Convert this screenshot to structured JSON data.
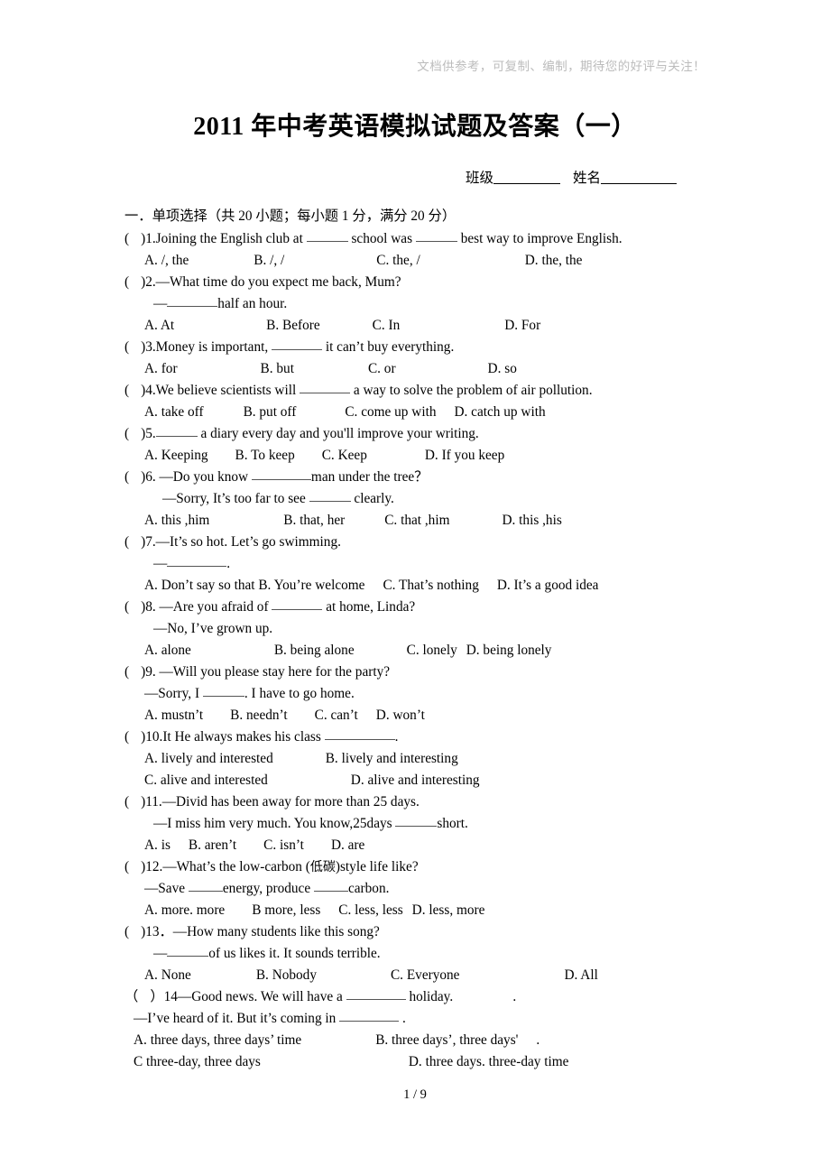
{
  "watermark": "文档供参考，可复制、编制，期待您的好评与关注！",
  "title": "2011 年中考英语模拟试题及答案（一）",
  "id_line": {
    "class_label": "班级",
    "name_label": "姓名"
  },
  "section": {
    "heading": "一．单项选择（共 20 小题；每小题 1 分，满分 20 分）"
  },
  "questions": [
    {
      "number": "1",
      "stem_a": ")1.Joining the English club at",
      "stem_b": "school was",
      "stem_c": "best way to improve English.",
      "options": [
        "A. /, the",
        "B. /, /",
        "C. the, /",
        "D. the, the"
      ]
    },
    {
      "number": "2",
      "stem_a": ")2.—What time do you expect me back, Mum?",
      "reply_pre": "—",
      "reply_post": "half an hour.",
      "options": [
        "A. At",
        "B. Before",
        "C. In",
        "D. For"
      ]
    },
    {
      "number": "3",
      "stem_a": ")3.Money is important,",
      "stem_b": "it can’t buy everything.",
      "options": [
        "A. for",
        "B. but",
        "C. or",
        "D. so"
      ]
    },
    {
      "number": "4",
      "stem_a": ")4.We believe scientists will",
      "stem_b": "a way to solve the problem of air pollution.",
      "options": [
        "A. take off",
        "B. put off",
        "C. come up with",
        "D. catch up with"
      ]
    },
    {
      "number": "5",
      "stem_a": ")5.",
      "stem_b": "a diary every day and you'll improve your writing.",
      "options": [
        "A. Keeping",
        "B. To keep",
        "C. Keep",
        "D. If you keep"
      ]
    },
    {
      "number": "6",
      "stem_a": ")6. —Do you know",
      "stem_b": "man under the tree？",
      "reply_pre": "—Sorry, It’s too far to see",
      "reply_post": "clearly.",
      "options": [
        "A. this ,him",
        "B. that, her",
        "C. that ,him",
        "D. this ,his"
      ]
    },
    {
      "number": "7",
      "stem_a": ")7.—It’s so hot. Let’s go swimming.",
      "reply_pre": "—",
      "reply_post": ".",
      "options": [
        "A. Don’t say so that",
        "B. You’re welcome",
        "C. That’s nothing",
        "D. It’s a good idea"
      ]
    },
    {
      "number": "8",
      "stem_a": ")8. —Are you afraid of",
      "stem_b": "at home, Linda?",
      "reply_pre": "—No, I’ve grown up.",
      "options": [
        "A. alone",
        "B. being alone",
        "C. lonely",
        "D. being lonely"
      ]
    },
    {
      "number": "9",
      "stem_a": ")9. —Will you please stay here for the party?",
      "reply_pre": "—Sorry, I",
      "reply_post": ". I have to go home.",
      "options": [
        "A. mustn’t",
        "B. needn’t",
        "C. can’t",
        "D. won’t"
      ]
    },
    {
      "number": "10",
      "stem_a": ")10.It He always makes his class",
      "stem_b": ".",
      "options": [
        "A. lively and interested",
        "B. lively and interesting",
        "C. alive and interested",
        "D. alive and interesting"
      ]
    },
    {
      "number": "11",
      "stem_a": ")11.—Divid has been away for more than 25 days.",
      "reply_pre": "—I miss him very much. You know,25days",
      "reply_post": "short.",
      "options": [
        "A. is",
        "B. aren’t",
        "C. isn’t",
        "D. are"
      ]
    },
    {
      "number": "12",
      "stem_a": ")12.—What’s the low-carbon (",
      "stem_zh": "低碳",
      "stem_b": ")style life like?",
      "reply_pre": "—Save",
      "reply_mid": "energy, produce",
      "reply_post": "carbon.",
      "options": [
        "A. more. more",
        "B more, less",
        "C. less, less",
        "D. less, more"
      ]
    },
    {
      "number": "13",
      "stem_a": ")13．—How many students like this song?",
      "reply_pre": "—",
      "reply_post": "of us likes it. It sounds terrible.",
      "options": [
        "A. None",
        "B. Nobody",
        "C. Everyone",
        "D. All"
      ]
    },
    {
      "number": "14",
      "stem_a": "）14—Good news. We will have a",
      "stem_b": "holiday.",
      "stem_trail": ".",
      "reply_pre": "—I’ve heard of it. But it’s coming in",
      "reply_post": ".",
      "options": [
        "A. three days, three days’ time",
        "B. three days’, three days'",
        "C three-day, three days",
        "D. three days. three-day time"
      ],
      "options_trail": "."
    }
  ],
  "footer": {
    "page": "1 / 9"
  }
}
